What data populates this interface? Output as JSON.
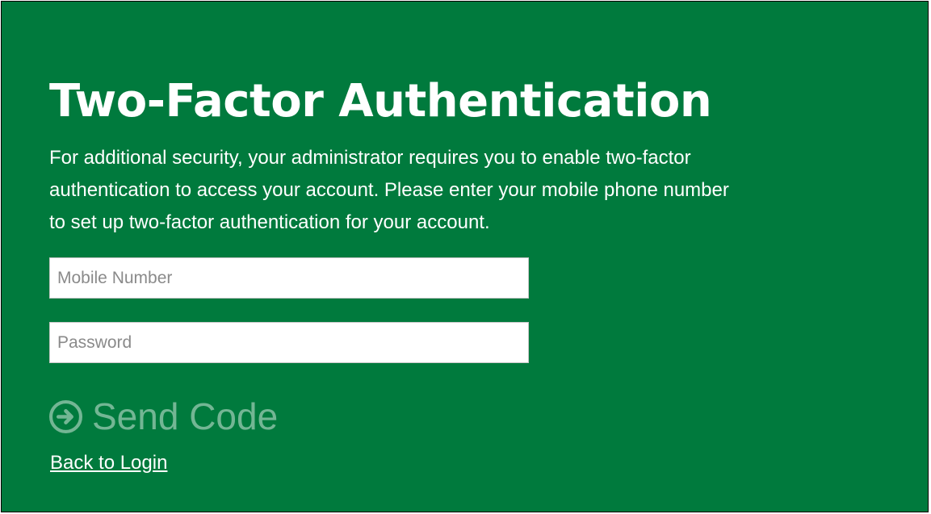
{
  "page": {
    "title": "Two-Factor Authentication",
    "description_lines": [
      "For additional security, your administrator requires you to enable two-factor",
      "authentication to access your account. Please enter your mobile phone number",
      "to set up two-factor authentication for your account."
    ]
  },
  "form": {
    "mobile_placeholder": "Mobile Number",
    "mobile_value": "",
    "password_placeholder": "Password",
    "password_value": "",
    "send_label": "Send Code",
    "send_icon": "arrow-circle-right-icon",
    "back_label": "Back to Login"
  },
  "colors": {
    "background": "#007a3d",
    "text": "#ffffff",
    "disabled_button": "rgba(255,255,255,0.45)"
  }
}
